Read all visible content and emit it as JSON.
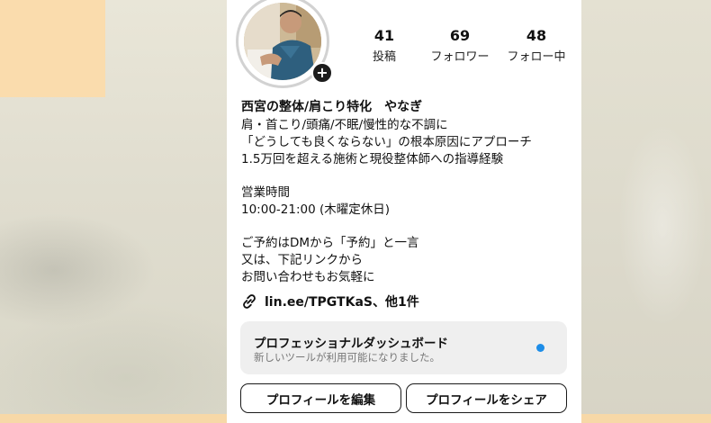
{
  "profile": {
    "name": "西宮の整体/肩こり特化　やなぎ",
    "stats": [
      {
        "value": "41",
        "label": "投稿"
      },
      {
        "value": "69",
        "label": "フォロワー"
      },
      {
        "value": "48",
        "label": "フォロー中"
      }
    ],
    "bio_lines": [
      "肩・首こり/頭痛/不眠/慢性的な不調に",
      "「どうしても良くならない」の根本原因にアプローチ",
      "1.5万回を超える施術と現役整体師への指導経験",
      "",
      "営業時間",
      "10:00-21:00 (木曜定休日)",
      "",
      "ご予約はDMから「予約」と一言",
      "又は、下記リンクから",
      "お問い合わせもお気軽に"
    ],
    "link_text": "lin.ee/TPGTKaS、他1件",
    "link_icon": "link-icon",
    "avatar_badge_icon": "plus-icon"
  },
  "dashboard": {
    "title": "プロフェッショナルダッシュボード",
    "subtitle": "新しいツールが利用可能になりました。",
    "dot_color": "#1d8de8"
  },
  "buttons": {
    "edit_profile": "プロフィールを編集",
    "share_profile": "プロフィールをシェア"
  }
}
